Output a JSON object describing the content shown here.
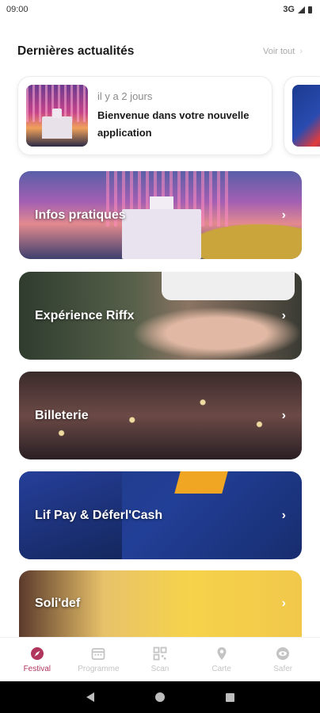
{
  "status_bar": {
    "time": "09:00",
    "network": "3G"
  },
  "news": {
    "title": "Dernières actualités",
    "see_all": "Voir tout",
    "items": [
      {
        "date": "il y a 2 jours",
        "headline": "Bienvenue dans votre nouvelle application"
      }
    ]
  },
  "features": [
    {
      "label": "Infos pratiques"
    },
    {
      "label": "Expérience Riffx"
    },
    {
      "label": "Billeterie"
    },
    {
      "label": "Lif Pay & Déferl'Cash"
    },
    {
      "label": "Soli'def"
    }
  ],
  "bottom_nav": {
    "active": "Festival",
    "items": [
      {
        "label": "Festival",
        "icon": "compass-icon"
      },
      {
        "label": "Programme",
        "icon": "calendar-icon"
      },
      {
        "label": "Scan",
        "icon": "qr-code-icon"
      },
      {
        "label": "Carte",
        "icon": "map-pin-icon"
      },
      {
        "label": "Safer",
        "icon": "shield-eye-icon"
      }
    ]
  },
  "colors": {
    "accent": "#b1365e",
    "inactive": "#c4c4c4"
  }
}
